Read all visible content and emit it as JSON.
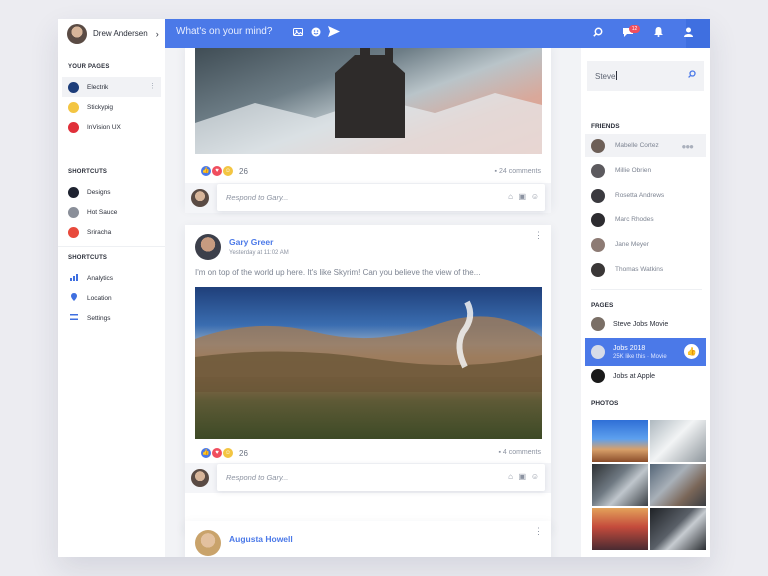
{
  "header": {
    "user_name": "Drew Andersen",
    "composer_placeholder": "What's on your mind?",
    "notification_count": "12",
    "icons": [
      "photo-icon",
      "emoji-icon",
      "send-icon",
      "search-icon",
      "chat-icon",
      "bell-icon",
      "profile-icon"
    ]
  },
  "sidebar": {
    "your_pages_title": "YOUR PAGES",
    "pages": [
      {
        "label": "Electrik",
        "color": "#1d3d7a"
      },
      {
        "label": "Stickypig",
        "color": "#f3c542"
      },
      {
        "label": "InVision UX",
        "color": "#e0303a"
      }
    ],
    "shortcuts_title_1": "SHORTCUTS",
    "shortcuts_1": [
      {
        "label": "Designs",
        "color": "#1e2230"
      },
      {
        "label": "Hot Sauce",
        "color": "#8a8f99"
      },
      {
        "label": "Sriracha",
        "color": "#e84a3c"
      }
    ],
    "shortcuts_title_2": "SHORTCUTS",
    "shortcuts_2": [
      {
        "label": "Analytics",
        "icon": "bar-chart-icon"
      },
      {
        "label": "Location",
        "icon": "location-pin-icon"
      },
      {
        "label": "Settings",
        "icon": "settings-icon"
      }
    ]
  },
  "feed": {
    "post1": {
      "reaction_count": "26",
      "comments": "24 comments",
      "respond_placeholder": "Respond to Gary..."
    },
    "post2": {
      "author": "Gary Greer",
      "timestamp": "Yesterday at 11:02 AM",
      "text": "I'm on top of the world up here. It's like Skyrim! Can you believe the view of the...",
      "reaction_count": "26",
      "comments": "4 comments",
      "respond_placeholder": "Respond to Gary..."
    },
    "post3": {
      "author": "Augusta Howell"
    }
  },
  "rightbar": {
    "search_value": "Steve",
    "friends_title": "FRIENDS",
    "friends": [
      "Mabelle Cortez",
      "Millie Obrien",
      "Rosetta Andrews",
      "Marc Rhodes",
      "Jane Meyer",
      "Thomas Watkins"
    ],
    "pages_title": "PAGES",
    "pages": [
      {
        "name": "Steve Jobs Movie"
      },
      {
        "name": "Jobs 2018",
        "sub": "25K like this · Movie"
      },
      {
        "name": "Jobs at Apple"
      }
    ],
    "photos_title": "PHOTOS"
  },
  "colors": {
    "accent": "#4b79e8",
    "badge": "#f04e5e"
  }
}
